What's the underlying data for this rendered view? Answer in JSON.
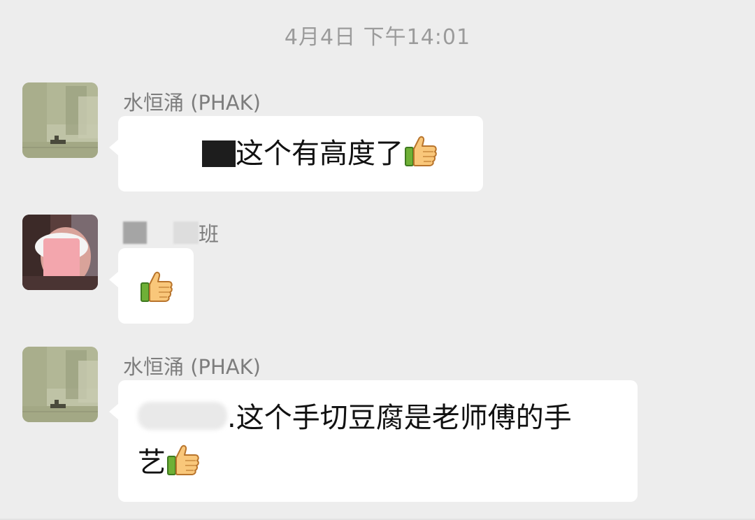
{
  "timestamp": "4月4日 下午14:01",
  "messages": [
    {
      "sender": "水恒涌 (PHAK)",
      "text": "这个有高度了",
      "emoji": "thumbs-up"
    },
    {
      "sender_suffix": "班",
      "text": "",
      "emoji": "thumbs-up"
    },
    {
      "sender": "水恒涌 (PHAK)",
      "text_line1": ".这个手切豆腐是老师傅的手",
      "text_line2": "艺",
      "emoji": "thumbs-up"
    }
  ],
  "colors": {
    "background": "#ededed",
    "bubble": "#ffffff",
    "timestamp": "#9b9b9b",
    "sender": "#7d7d7d",
    "text": "#111111"
  }
}
